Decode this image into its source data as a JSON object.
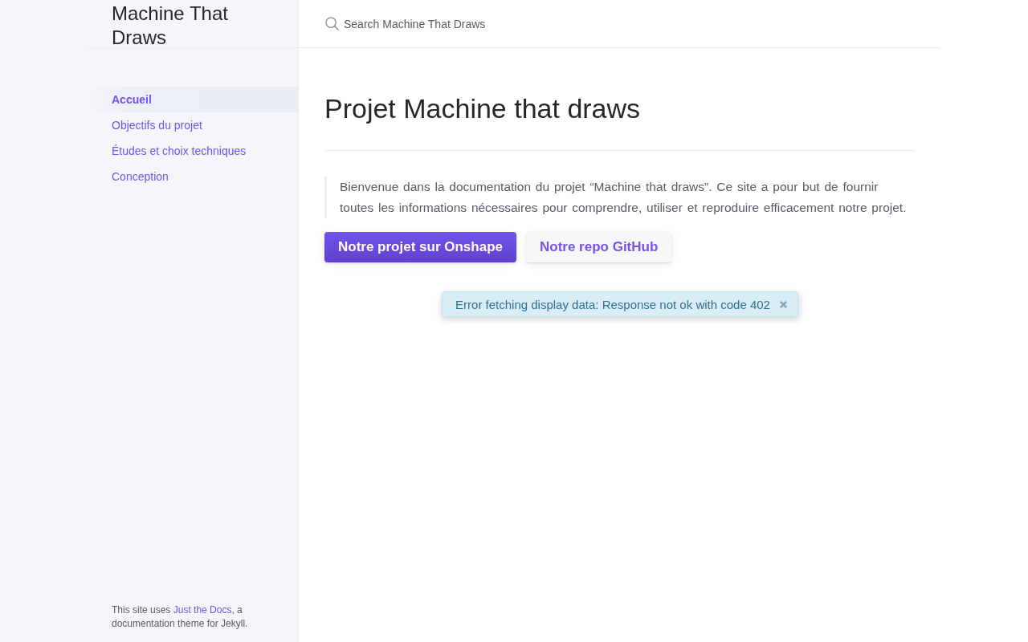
{
  "site_title": "Machine That Draws",
  "sidebar": {
    "nav_items": [
      {
        "label": "Accueil",
        "selected": true
      },
      {
        "label": "Objectifs du projet",
        "selected": false
      },
      {
        "label": "Études et choix techniques",
        "selected": false
      },
      {
        "label": "Conception",
        "selected": false
      }
    ],
    "footer": {
      "before": "This site uses ",
      "link": "Just the Docs",
      "after": ", a documentation theme for Jekyll."
    }
  },
  "search": {
    "placeholder": "Search Machine That Draws"
  },
  "page": {
    "title": "Projet Machine that draws",
    "intro": "Bienvenue dans la documentation du projet “Machine that draws”. Ce site a pour but de fournir toutes les informations nécessaires pour comprendre, utiliser et reproduire efficacement notre projet.",
    "buttons": [
      {
        "label": "Notre projet sur Onshape",
        "kind": "primary"
      },
      {
        "label": "Notre repo GitHub",
        "kind": "secondary"
      }
    ]
  },
  "notification": {
    "message": "Error fetching display data: Response not ok with code 402"
  }
}
